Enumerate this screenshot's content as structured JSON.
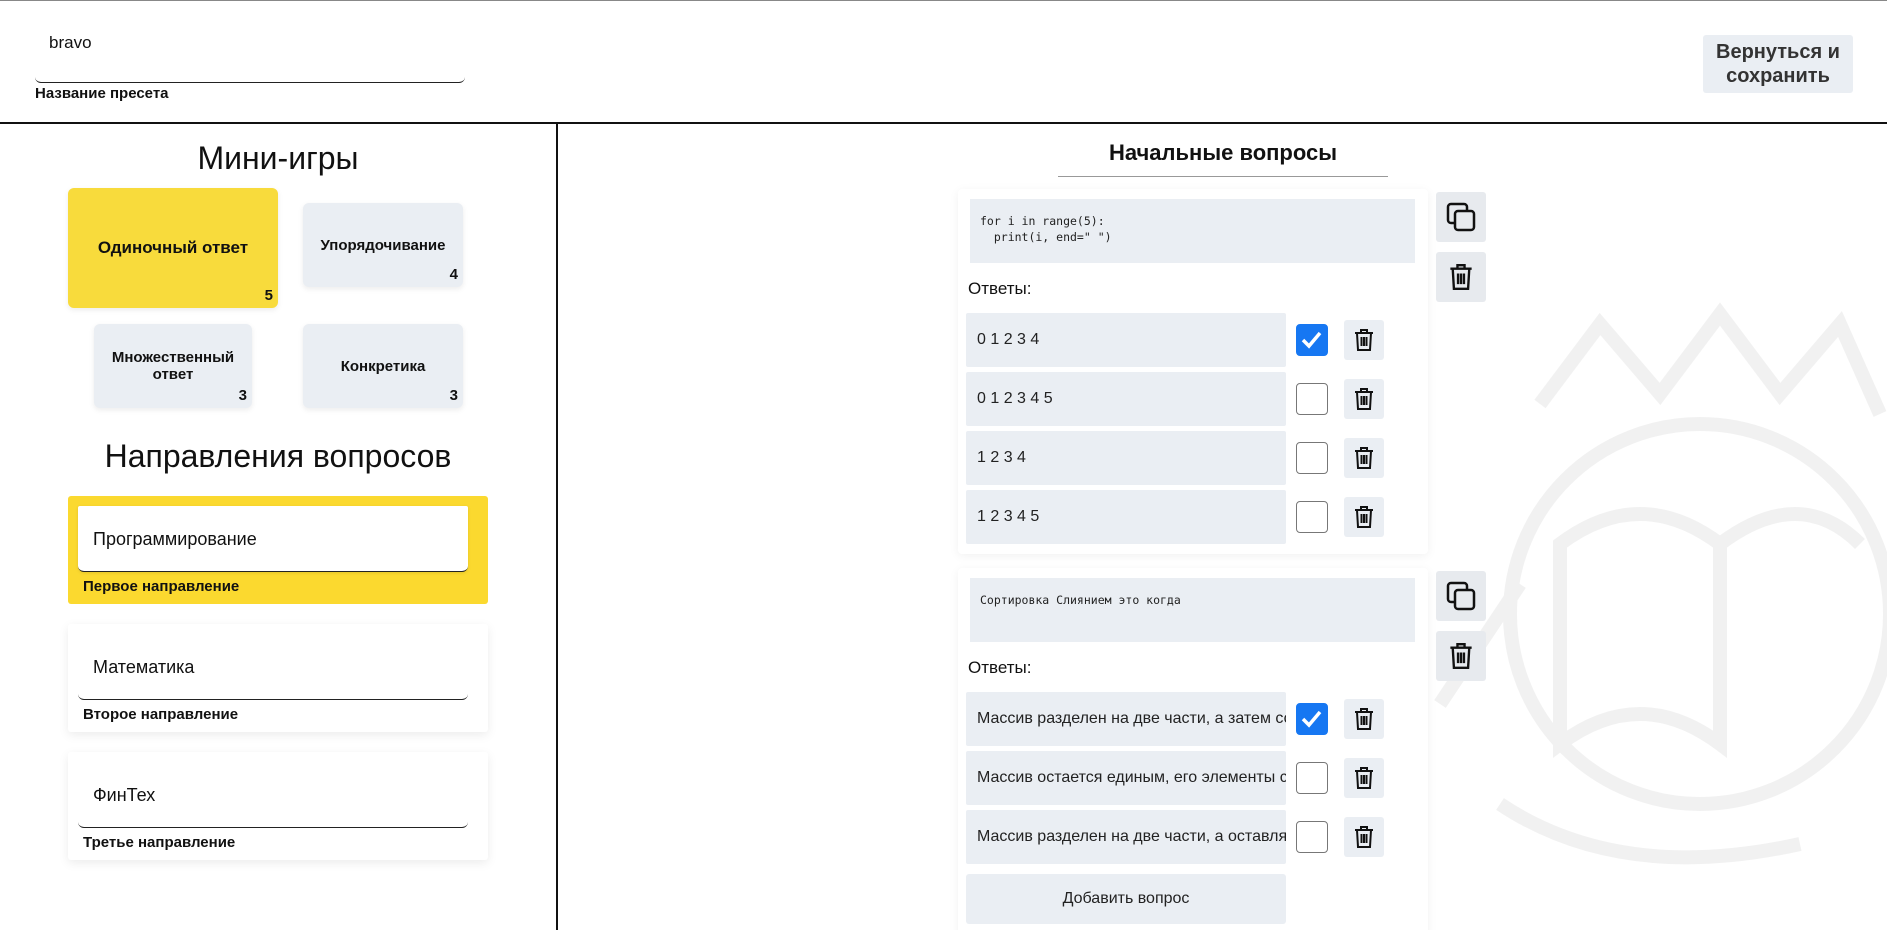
{
  "preset": {
    "value": "bravo",
    "caption": "Название пресета"
  },
  "header": {
    "back_button": "Вернуться и\nсохранить"
  },
  "minigames": {
    "title": "Мини-игры",
    "items": [
      {
        "label": "Одиночный ответ",
        "count": "5",
        "active": true
      },
      {
        "label": "Упорядочивание",
        "count": "4",
        "active": false
      },
      {
        "label": "Множественный ответ",
        "count": "3",
        "active": false
      },
      {
        "label": "Конкретика",
        "count": "3",
        "active": false
      }
    ]
  },
  "directions": {
    "title": "Направления вопросов",
    "items": [
      {
        "value": "Программирование",
        "caption": "Первое направление",
        "active": true
      },
      {
        "value": "Математика",
        "caption": "Второе направление",
        "active": false
      },
      {
        "value": "ФинТех",
        "caption": "Третье направление",
        "active": false
      }
    ]
  },
  "main": {
    "title": "Начальные вопросы",
    "answers_label": "Ответы:",
    "add_question": "Добавить вопрос",
    "questions": [
      {
        "text": "for i in range(5):\n  print(i, end=\" \")",
        "answers": [
          {
            "text": "0 1 2 3 4",
            "correct": true
          },
          {
            "text": "0 1 2 3 4 5",
            "correct": false
          },
          {
            "text": "1 2 3 4",
            "correct": false
          },
          {
            "text": "1 2 3 4 5",
            "correct": false
          }
        ]
      },
      {
        "text": "Сортировка Слиянием это когда",
        "answers": [
          {
            "text": "Массив разделен на две части, а затем соединяется",
            "correct": true
          },
          {
            "text": "Массив остается единым, его элементы сравниваются",
            "correct": false
          },
          {
            "text": "Массив разделен на две части, а оставляется",
            "correct": false
          }
        ]
      }
    ]
  },
  "colors": {
    "accent_yellow": "#f8db3c",
    "panel_gray": "#eaeef3",
    "check_blue": "#1677f2"
  }
}
